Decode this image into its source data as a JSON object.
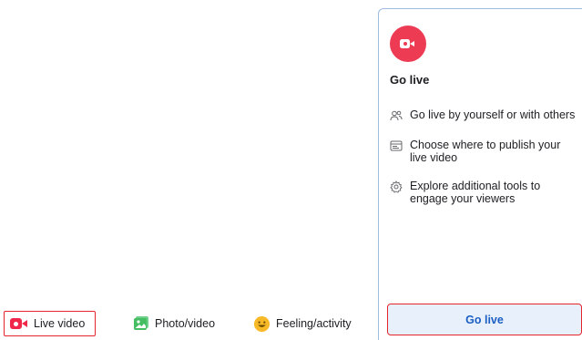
{
  "composer": {
    "actions": [
      {
        "label": "Live video",
        "icon": "live-video-icon",
        "color": "#f02849"
      },
      {
        "label": "Photo/video",
        "icon": "photo-icon",
        "color": "#45bd62"
      },
      {
        "label": "Feeling/activity",
        "icon": "smiley-icon",
        "color": "#f7b928"
      }
    ]
  },
  "panel": {
    "badge_icon": "live-video-icon",
    "badge_color": "#ec3b53",
    "title": "Go live",
    "features": [
      {
        "icon": "people-icon",
        "text": "Go live by yourself or with others"
      },
      {
        "icon": "browser-window-icon",
        "text": "Choose where to publish your live video"
      },
      {
        "icon": "gear-icon",
        "text": "Explore additional tools to engage your viewers"
      }
    ],
    "button_label": "Go live"
  },
  "colors": {
    "highlight_border": "#e4262c",
    "button_bg": "#e7f0fb",
    "button_text": "#1b5fc4",
    "panel_border": "#9fbbe0"
  }
}
